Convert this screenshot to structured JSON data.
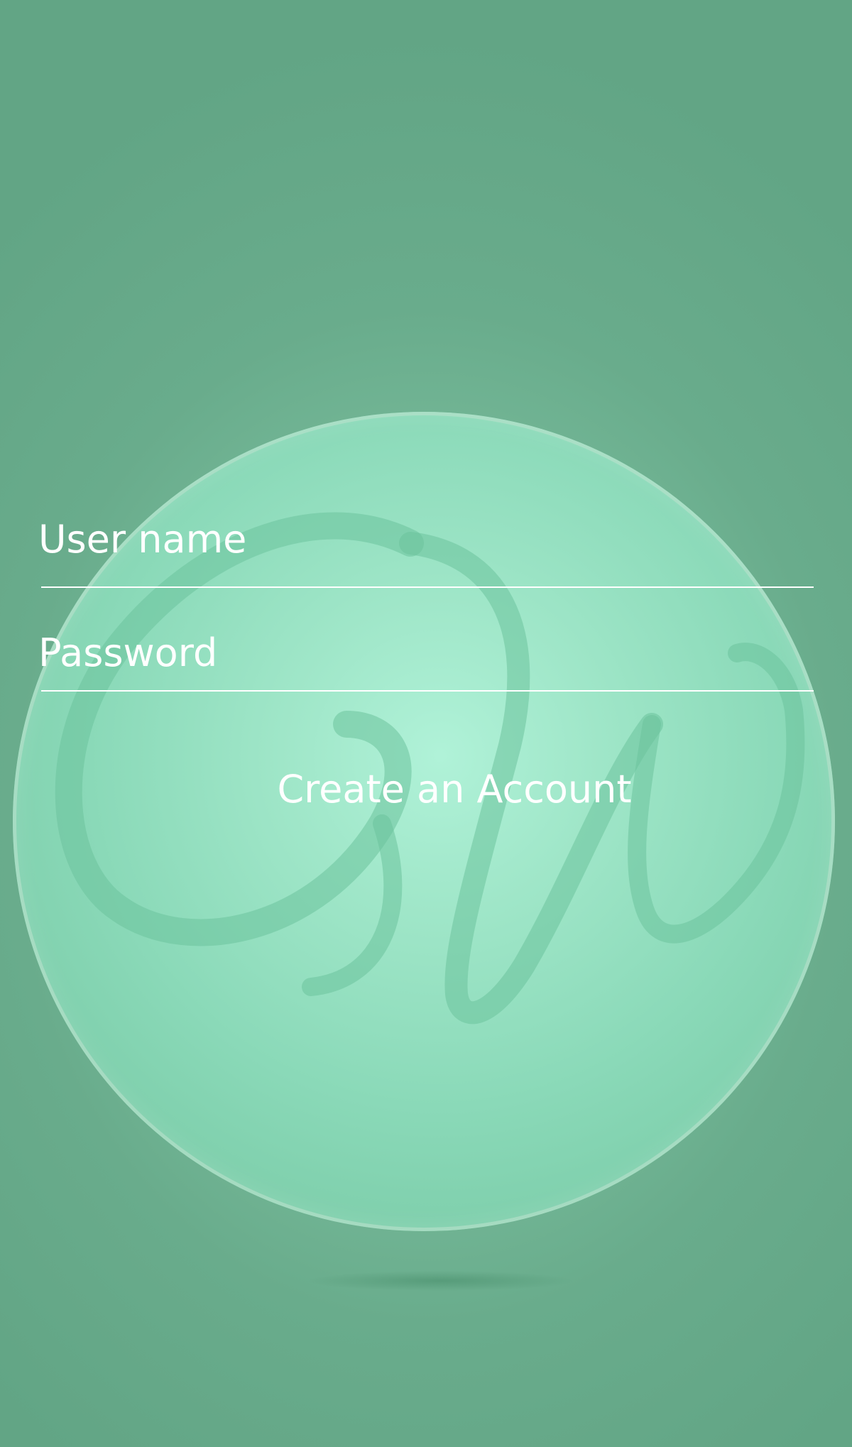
{
  "login_form": {
    "username_placeholder": "User name",
    "password_placeholder": "Password"
  },
  "actions": {
    "create_account_label": "Create an Account"
  },
  "colors": {
    "background": "#65a887",
    "orb": "#9fe6c8",
    "text": "#ffffff"
  },
  "icons": {
    "logo": "script-monogram-logo"
  }
}
